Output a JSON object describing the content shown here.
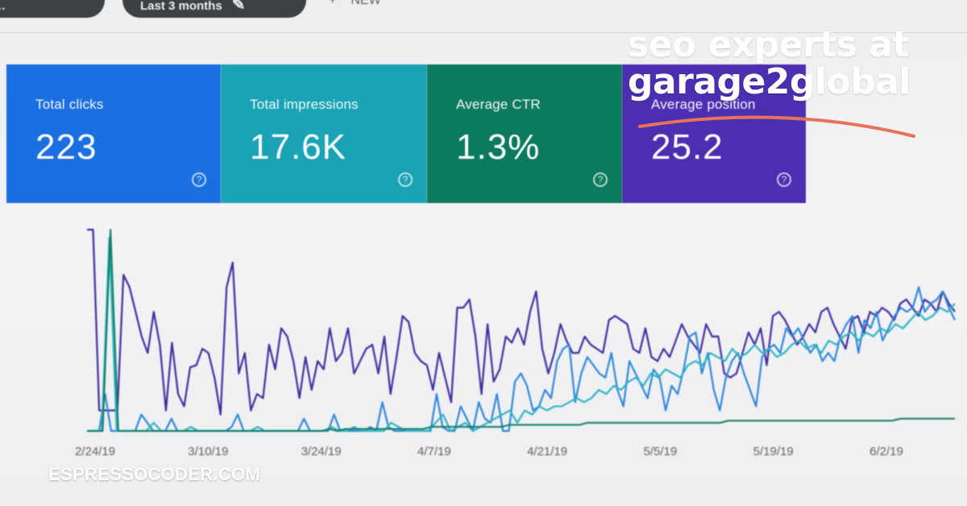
{
  "toolbar": {
    "filter_pill_label": "…",
    "date_range_label": "Last 3 months",
    "new_label": "NEW",
    "new_icon": "plus-icon"
  },
  "metrics": [
    {
      "label": "Total clicks",
      "value": "223",
      "color": "#1b6fe0"
    },
    {
      "label": "Total impressions",
      "value": "17.6K",
      "color": "#19a3b5"
    },
    {
      "label": "Average CTR",
      "value": "1.3%",
      "color": "#0c7a5c"
    },
    {
      "label": "Average position",
      "value": "25.2",
      "color": "#4b2fb0"
    }
  ],
  "overlay": {
    "title_line1": "seo experts at",
    "title_line2": "garage2global",
    "accent_color": "#e8715c"
  },
  "watermark": "ESPRESSOCODER.COM",
  "chart_data": {
    "type": "line",
    "x_tick_labels": [
      "2/24/19",
      "3/10/19",
      "3/24/19",
      "4/7/19",
      "4/21/19",
      "5/5/19",
      "5/19/19",
      "6/2/19"
    ],
    "ylim": [
      0,
      100
    ],
    "grid": false,
    "series": [
      {
        "color": "#3f2a9a",
        "values": [
          100,
          100,
          12,
          12,
          12,
          12,
          78,
          72,
          60,
          48,
          40,
          60,
          44,
          12,
          45,
          20,
          14,
          33,
          34,
          42,
          40,
          28,
          10,
          72,
          84,
          30,
          40,
          12,
          20,
          18,
          44,
          32,
          52,
          48,
          36,
          18,
          38,
          22,
          36,
          32,
          52,
          36,
          40,
          52,
          30,
          36,
          42,
          44,
          30,
          48,
          20,
          38,
          58,
          55,
          40,
          36,
          34,
          22,
          40,
          28,
          16,
          62,
          62,
          66,
          48,
          20,
          54,
          26,
          32,
          48,
          45,
          52,
          44,
          60,
          70,
          42,
          30,
          40,
          54,
          46,
          40,
          40,
          48,
          44,
          42,
          40,
          56,
          58,
          56,
          54,
          42,
          40,
          52,
          38,
          36,
          42,
          38,
          46,
          54,
          48,
          44,
          40,
          54,
          48,
          48,
          30,
          28,
          30,
          40,
          50,
          44,
          52,
          34,
          58,
          60,
          56,
          50,
          44,
          48,
          54,
          50,
          60,
          62,
          54,
          48,
          42,
          56,
          58,
          50,
          60,
          58,
          62,
          60,
          56,
          64,
          66,
          62,
          58,
          66,
          64,
          60,
          70,
          64,
          60
        ]
      },
      {
        "color": "#2d86d6",
        "values": [
          2,
          2,
          2,
          20,
          2,
          2,
          2,
          2,
          2,
          10,
          6,
          2,
          2,
          2,
          8,
          2,
          2,
          2,
          2,
          2,
          2,
          2,
          2,
          2,
          4,
          10,
          2,
          2,
          2,
          2,
          2,
          2,
          2,
          2,
          2,
          2,
          8,
          2,
          2,
          2,
          2,
          10,
          2,
          2,
          2,
          2,
          2,
          4,
          2,
          16,
          4,
          2,
          2,
          2,
          2,
          2,
          2,
          2,
          20,
          4,
          2,
          2,
          14,
          8,
          2,
          16,
          8,
          6,
          20,
          2,
          2,
          26,
          30,
          24,
          12,
          14,
          22,
          18,
          36,
          42,
          44,
          16,
          30,
          38,
          34,
          30,
          28,
          40,
          22,
          14,
          36,
          30,
          24,
          18,
          32,
          28,
          12,
          24,
          20,
          32,
          48,
          50,
          30,
          40,
          22,
          12,
          28,
          36,
          40,
          30,
          22,
          14,
          38,
          42,
          44,
          40,
          52,
          48,
          52,
          46,
          40,
          44,
          36,
          40,
          36,
          48,
          54,
          58,
          40,
          56,
          52,
          60,
          46,
          52,
          58,
          62,
          60,
          62,
          72,
          60,
          64,
          66,
          70,
          62,
          56
        ]
      },
      {
        "color": "#2cb3c4",
        "values": [
          2,
          2,
          2,
          96,
          2,
          2,
          2,
          2,
          2,
          6,
          2,
          2,
          2,
          2,
          4,
          2,
          2,
          2,
          2,
          2,
          2,
          2,
          2,
          4,
          2,
          2,
          2,
          2,
          2,
          2,
          2,
          2,
          2,
          4,
          2,
          2,
          4,
          2,
          2,
          2,
          2,
          6,
          4,
          2,
          2,
          2,
          2,
          6,
          10,
          2,
          4,
          6,
          2,
          4,
          6,
          8,
          10,
          12,
          6,
          12,
          10,
          14,
          12,
          14,
          14,
          16,
          18,
          16,
          18,
          22,
          20,
          24,
          22,
          26,
          28,
          24,
          30,
          28,
          32,
          30,
          28,
          34,
          36,
          34,
          40,
          38,
          36,
          42,
          38,
          40,
          44,
          40,
          42,
          38,
          40,
          44,
          46,
          42,
          44,
          40,
          46,
          44,
          48,
          50,
          46,
          50,
          48,
          52,
          50,
          54,
          52,
          56,
          60,
          56,
          58,
          62,
          60,
          64
        ]
      },
      {
        "color": "#0c7a5c",
        "values": [
          2,
          2,
          2,
          100,
          2,
          2,
          2,
          2,
          2,
          2,
          2,
          2,
          2,
          2,
          2,
          2,
          2,
          2,
          2,
          2,
          2,
          2,
          2,
          2,
          2,
          2,
          2,
          2,
          2,
          2,
          2,
          3,
          2,
          3,
          3,
          3,
          3,
          3,
          3,
          3,
          3,
          3,
          3,
          3,
          4,
          4,
          4,
          4,
          4,
          4,
          4,
          4,
          4,
          4,
          5,
          5,
          5,
          5,
          5,
          5,
          5,
          5,
          5,
          5,
          6,
          6,
          6,
          6,
          6,
          6,
          6,
          6,
          6,
          6,
          6,
          6,
          6,
          6,
          6,
          6,
          6,
          6,
          7,
          7,
          7,
          7,
          7,
          7,
          7,
          7,
          7,
          7,
          7,
          7,
          7,
          7,
          7,
          7,
          7,
          7,
          7,
          7,
          7,
          7,
          8,
          8,
          8,
          8,
          8,
          8,
          8,
          8
        ]
      }
    ]
  }
}
